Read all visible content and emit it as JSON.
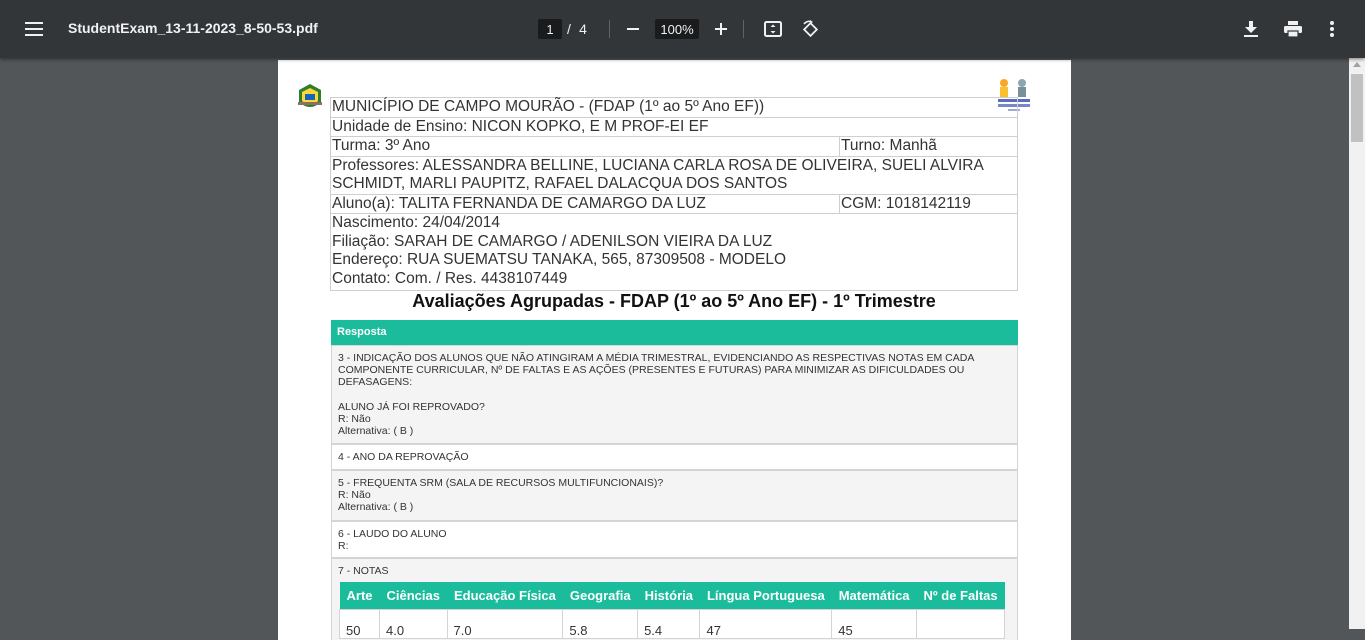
{
  "toolbar": {
    "filename": "StudentExam_13-11-2023_8-50-53.pdf",
    "current_page": "1",
    "page_separator": "/",
    "total_pages": "4",
    "zoom": "100%"
  },
  "document": {
    "header": {
      "municipality": "MUNICÍPIO DE CAMPO MOURÃO - (FDAP (1º ao 5º Ano EF))",
      "school": "Unidade de Ensino: NICON KOPKO, E M PROF-EI EF",
      "class": "Turma: 3º Ano",
      "shift": "Turno: Manhã",
      "teachers_line1": "Professores: ALESSANDRA BELLINE, LUCIANA CARLA ROSA DE OLIVEIRA, SUELI ALVIRA",
      "teachers_line2": "SCHMIDT, MARLI PAUPITZ, RAFAEL DALACQUA DOS SANTOS",
      "student": "Aluno(a): TALITA FERNANDA DE CAMARGO DA LUZ",
      "cgm": "CGM: 1018142119",
      "birth": "Nascimento: 24/04/2014",
      "parents": "Filiação: SARAH DE CAMARGO / ADENILSON VIEIRA DA LUZ",
      "address": "Endereço: RUA SUEMATSU TANAKA, 565, 87309508 - MODELO",
      "contact": "Contato: Com.  / Res. 4438107449"
    },
    "title": "Avaliações Agrupadas - FDAP (1º ao 5º Ano EF) - 1º Trimestre",
    "response_header": "Resposta",
    "q3": {
      "line1": "3 - INDICAÇÃO DOS ALUNOS QUE NÃO ATINGIRAM A MÉDIA TRIMESTRAL, EVIDENCIANDO AS RESPECTIVAS NOTAS EM CADA",
      "line2": "COMPONENTE CURRICULAR, Nº DE FALTAS E AS AÇÕES (PRESENTES E FUTURAS) PARA MINIMIZAR AS DIFICULDADES OU",
      "line3": "DEFASAGENS:",
      "sub": "ALUNO JÁ FOI REPROVADO?",
      "answer": "R: Não",
      "alternative": "Alternativa: ( B )"
    },
    "q4": {
      "line1": "4 - ANO DA REPROVAÇÃO"
    },
    "q5": {
      "line1": "5 - FREQUENTA SRM (SALA DE RECURSOS MULTIFUNCIONAIS)?",
      "answer": "R: Não",
      "alternative": "Alternativa: ( B )"
    },
    "q6": {
      "line1": "6 - LAUDO DO ALUNO",
      "answer": "R:"
    },
    "q7": {
      "line1": "7 - NOTAS",
      "headers": [
        "Arte",
        "Ciências",
        "Educação Física",
        "Geografia",
        "História",
        "Língua Portuguesa",
        "Matemática",
        "Nº de Faltas"
      ],
      "values": [
        "50",
        "4.0",
        "7.0",
        "5.8",
        "5.4",
        "47",
        "45",
        ""
      ]
    }
  },
  "colors": {
    "toolbar_bg": "#323639",
    "viewer_bg": "#525659",
    "accent_teal": "#1abc9c"
  },
  "icons": [
    "menu-icon",
    "zoom-out-icon",
    "zoom-in-icon",
    "fit-page-icon",
    "rotate-icon",
    "download-icon",
    "print-icon",
    "more-vert-icon"
  ]
}
